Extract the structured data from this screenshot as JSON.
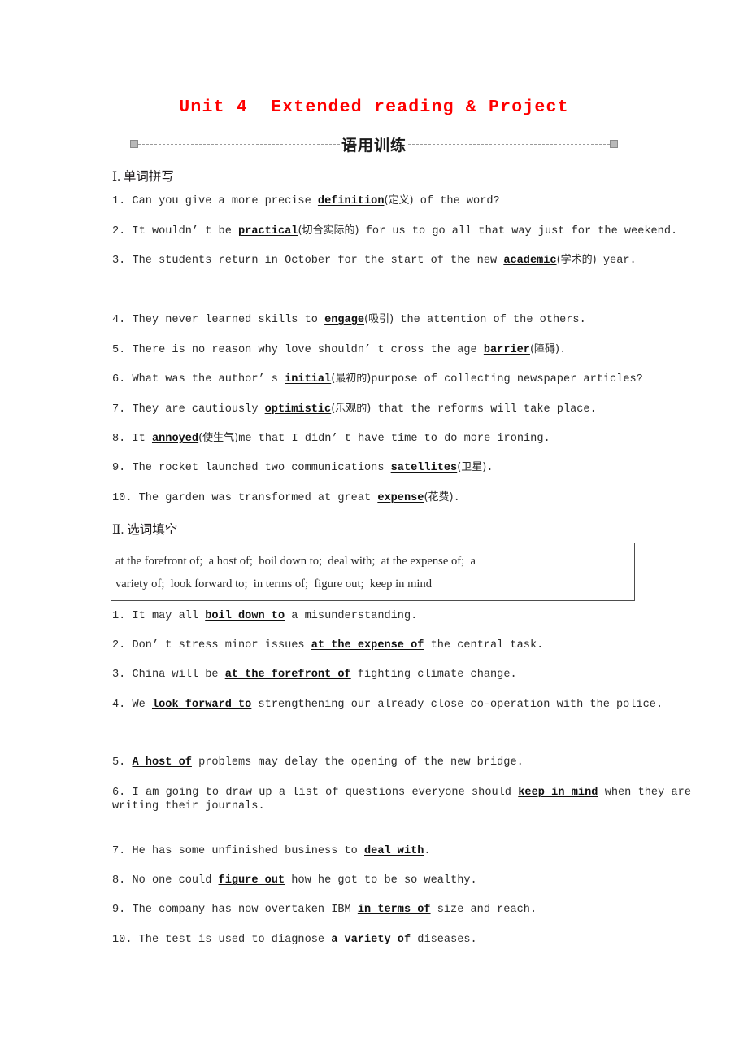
{
  "document": {
    "unit_title": "Unit 4  Extended reading & Project",
    "title_color": "#fe0000",
    "banner_label": "语用训练",
    "page_background": "#ffffff"
  },
  "sections": [
    {
      "heading": "Ⅰ. 单词拼写",
      "items": [
        {
          "num": "1.",
          "pre": "Can you give a more precise ",
          "answer": "definition",
          "hint": "(定义)",
          "post": " of the word?"
        },
        {
          "num": "2.",
          "pre": "It wouldn’ t be ",
          "answer": "practical",
          "hint": "(切合实际的)",
          "post": " for us to go all that way just for the weekend."
        },
        {
          "num": "3.",
          "pre": "The students return in October for the start of the new ",
          "answer": "academic",
          "hint": "(学术的)",
          "post": " year."
        },
        {
          "num": "4.",
          "pre": "They never learned skills to ",
          "answer": "engage",
          "hint": "(吸引)",
          "post": " the attention of the others."
        },
        {
          "num": "5.",
          "pre": "There is no reason why love shouldn’ t cross the age ",
          "answer": "barrier",
          "hint": "(障碍)",
          "post": "."
        },
        {
          "num": "6.",
          "pre": "What was the author’ s ",
          "answer": "initial",
          "hint": "(最初的)",
          "post": "purpose of collecting newspaper articles?"
        },
        {
          "num": "7.",
          "pre": "They are cautiously ",
          "answer": "optimistic",
          "hint": "(乐观的)",
          "post": " that the reforms will take place."
        },
        {
          "num": "8.",
          "pre": "It ",
          "answer": "annoyed",
          "hint": "(使生气)",
          "post": "me that I didn’ t have time to do more ironing."
        },
        {
          "num": "9.",
          "pre": "The rocket launched two communications ",
          "answer": "satellites",
          "hint": "(卫星)",
          "post": "."
        },
        {
          "num": "10.",
          "pre": "The garden was transformed at great ",
          "answer": "expense",
          "hint": "(花费)",
          "post": "."
        }
      ]
    },
    {
      "heading": "Ⅱ. 选词填空",
      "wordbank": {
        "line1": "at the forefront of;  a host of;  boil down to;  deal with;  at the expense of;  a",
        "line2": "variety of;  look forward to;  in terms of;  figure out;  keep in mind",
        "phrases": [
          "at the forefront of",
          "a host of",
          "boil down to",
          "deal with",
          "at the expense of",
          "a variety of",
          "look forward to",
          "in terms of",
          "figure out",
          "keep in mind"
        ]
      },
      "items": [
        {
          "num": "1.",
          "pre": "It may all ",
          "answer": "boil down to",
          "hint": "",
          "post": " a misunderstanding."
        },
        {
          "num": "2.",
          "pre": "Don’ t stress minor issues ",
          "answer": "at the expense of",
          "hint": "",
          "post": " the central task."
        },
        {
          "num": "3.",
          "pre": "China will be ",
          "answer": "at the forefront of",
          "hint": "",
          "post": " fighting climate change."
        },
        {
          "num": "4.",
          "pre": "We ",
          "answer": "look forward to",
          "hint": "",
          "post": " strengthening our already close co-operation with the police."
        },
        {
          "num": "5.",
          "pre": "",
          "answer": "A host of",
          "hint": "",
          "post": " problems may delay the opening of the new bridge."
        },
        {
          "num": "6.",
          "pre": "I am going to draw up a list of questions everyone should ",
          "answer": "keep in mind",
          "hint": "",
          "post": " when they are writing their journals."
        },
        {
          "num": "7.",
          "pre": "He has some unfinished business to ",
          "answer": "deal with",
          "hint": "",
          "post": "."
        },
        {
          "num": "8.",
          "pre": "No one could ",
          "answer": "figure out",
          "hint": "",
          "post": " how he got to be so wealthy."
        },
        {
          "num": "9.",
          "pre": "The company has now overtaken IBM ",
          "answer": "in terms of",
          "hint": "",
          "post": " size and reach."
        },
        {
          "num": "10.",
          "pre": "The test is used to diagnose ",
          "answer": "a variety of",
          "hint": "",
          "post": " diseases."
        }
      ]
    }
  ],
  "layout": {
    "s1_tops": [
      238,
      275,
      311,
      384,
      421,
      457,
      494,
      530,
      566,
      603
    ],
    "s2_tops": [
      749,
      785,
      821,
      858,
      929,
      966,
      1038,
      1074,
      1110,
      1147
    ]
  }
}
